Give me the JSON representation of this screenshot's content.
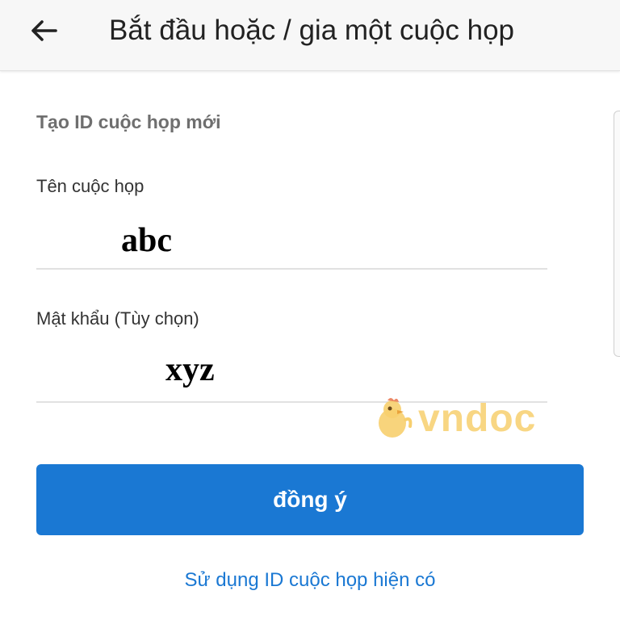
{
  "header": {
    "back_icon": "arrow-left-icon",
    "title": "Bắt đầu hoặc / gia một cuộc họp"
  },
  "form": {
    "section_title": "Tạo ID cuộc họp mới",
    "meeting_name": {
      "label": "Tên cuộc họp",
      "value": "abc"
    },
    "password": {
      "label": "Mật khẩu (Tùy chọn)",
      "value": "xyz"
    }
  },
  "watermark": {
    "text": "vndoc",
    "icon": "chicken-mascot-icon"
  },
  "actions": {
    "confirm_label": "đồng ý",
    "use_existing_label": "Sử dụng ID cuộc họp hiện có"
  },
  "colors": {
    "primary": "#1a78d3",
    "watermark": "#f7cf6e"
  }
}
